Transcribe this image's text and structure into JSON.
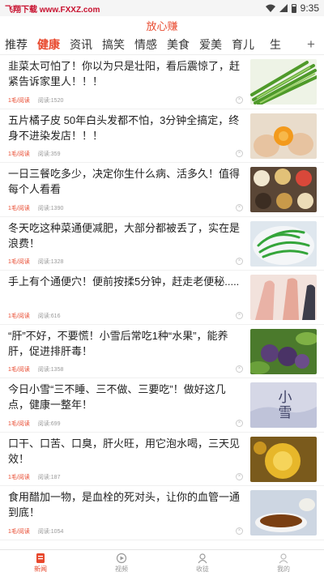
{
  "status_bar": {
    "watermark": "飞翔下载 www.FXXZ.com",
    "time": "9:35"
  },
  "header": {
    "title": "放心赚"
  },
  "tabs": [
    {
      "label": "推荐",
      "active": false
    },
    {
      "label": "健康",
      "active": true
    },
    {
      "label": "资讯",
      "active": false
    },
    {
      "label": "搞笑",
      "active": false
    },
    {
      "label": "情感",
      "active": false
    },
    {
      "label": "美食",
      "active": false
    },
    {
      "label": "爱美",
      "active": false
    },
    {
      "label": "育儿",
      "active": false
    },
    {
      "label": "生",
      "active": false
    }
  ],
  "tab_add_label": "+",
  "feed": [
    {
      "title": "韭菜太可怕了！你以为只是壮阳，看后震惊了，赶紧告诉家里人！！！",
      "tag": "1毛/阅读",
      "reads": "阅读:1520"
    },
    {
      "title": "五片橘子皮 50年白头发都不怕，3分钟全搞定，终身不进染发店！！！",
      "tag": "1毛/阅读",
      "reads": "阅读:359"
    },
    {
      "title": "一日三餐吃多少，决定你生什么病、活多久！值得每个人看看",
      "tag": "1毛/阅读",
      "reads": "阅读:1390"
    },
    {
      "title": "冬天吃这种菜通便减肥，大部分都被丢了，实在是浪费！",
      "tag": "1毛/阅读",
      "reads": "阅读:1328"
    },
    {
      "title": "手上有个通便穴！便前按揉5分钟，赶走老便秘.....",
      "tag": "1毛/阅读",
      "reads": "阅读:616"
    },
    {
      "title": "“肝”不好，不要慌！小雪后常吃1种“水果”，能养肝，促进排肝毒！",
      "tag": "1毛/阅读",
      "reads": "阅读:1358"
    },
    {
      "title": "今日小雪“三不睡、三不做、三要吃”！做好这几点，健康一整年！",
      "tag": "1毛/阅读",
      "reads": "阅读:699"
    },
    {
      "title": "口干、口苦、口臭，肝火旺，用它泡水喝，三天见效！",
      "tag": "1毛/阅读",
      "reads": "阅读:187"
    },
    {
      "title": "食用醋加一物，是血栓的死对头，让你的血管一通到底！",
      "tag": "1毛/阅读",
      "reads": "阅读:1054"
    }
  ],
  "close_glyph": "×",
  "thumb_text_xiaoxue": "小雪",
  "bottom_nav": [
    {
      "label": "新闻",
      "icon": "news-icon",
      "active": true
    },
    {
      "label": "视频",
      "icon": "video-icon",
      "active": false
    },
    {
      "label": "收徒",
      "icon": "user-icon",
      "active": false
    },
    {
      "label": "我的",
      "icon": "profile-icon",
      "active": false
    }
  ],
  "colors": {
    "accent": "#e8482d",
    "watermark": "#c8102e"
  }
}
